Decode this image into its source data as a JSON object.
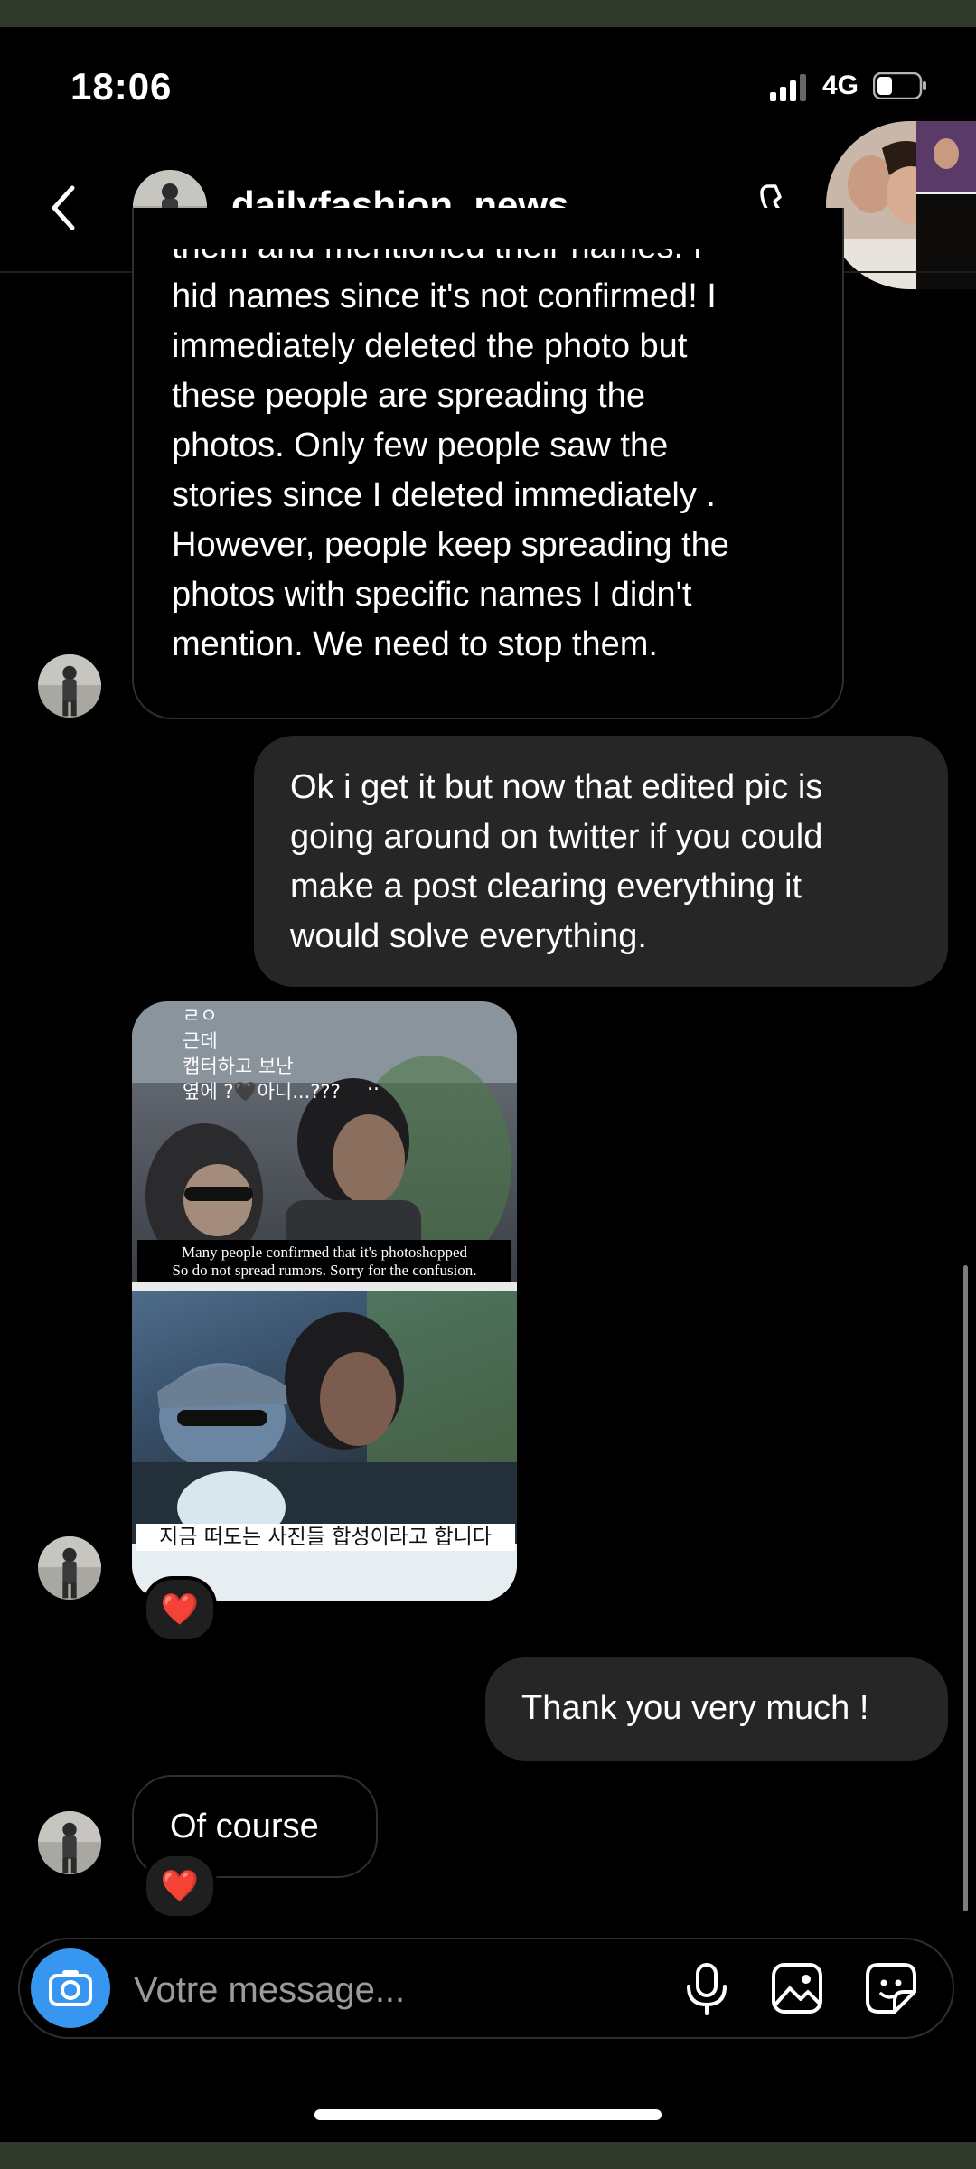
{
  "status_bar": {
    "time": "18:06",
    "network": "4G"
  },
  "header": {
    "username": "dailyfashion_news"
  },
  "messages": {
    "m1": {
      "direction": "incoming",
      "text": "them and mentioned their names. I\nhid names  since it's not confirmed! I\nimmediately deleted the photo but\nthese people are spreading the\nphotos. Only few people saw the\nstories since I deleted immediately .\nHowever, people keep spreading the\nphotos with specific names I didn't\nmention. We need to stop them."
    },
    "m2": {
      "direction": "outgoing",
      "text": "Ok i get it but now that edited pic is\ngoing around on twitter if you could\nmake a post clearing everything it\nwould solve everything."
    },
    "m3": {
      "direction": "incoming",
      "type": "image",
      "korean_top": "ㄹㅇ\n근데\n캡터하고 보난\n옆에 ?🖤아니...???",
      "caption_line1": "Many people confirmed that it's photoshopped",
      "caption_line2": "So do not spread rumors. Sorry for the confusion.",
      "korean_bottom": "지금 떠도는 사진들 합성이라고 합니다",
      "reaction": "❤️"
    },
    "m4": {
      "direction": "outgoing",
      "text": "Thank you very much !"
    },
    "m5": {
      "direction": "incoming",
      "text": "Of course",
      "reaction": "❤️"
    }
  },
  "composer": {
    "placeholder": "Votre message..."
  },
  "colors": {
    "accent_blue": "#3797f0",
    "outgoing_bubble": "#262626",
    "incoming_border": "#2e2e2e",
    "background": "#000000"
  },
  "icons": [
    "back-icon",
    "phone-icon",
    "camera-icon",
    "microphone-icon",
    "gallery-icon",
    "sticker-icon",
    "heart-reaction-icon"
  ]
}
